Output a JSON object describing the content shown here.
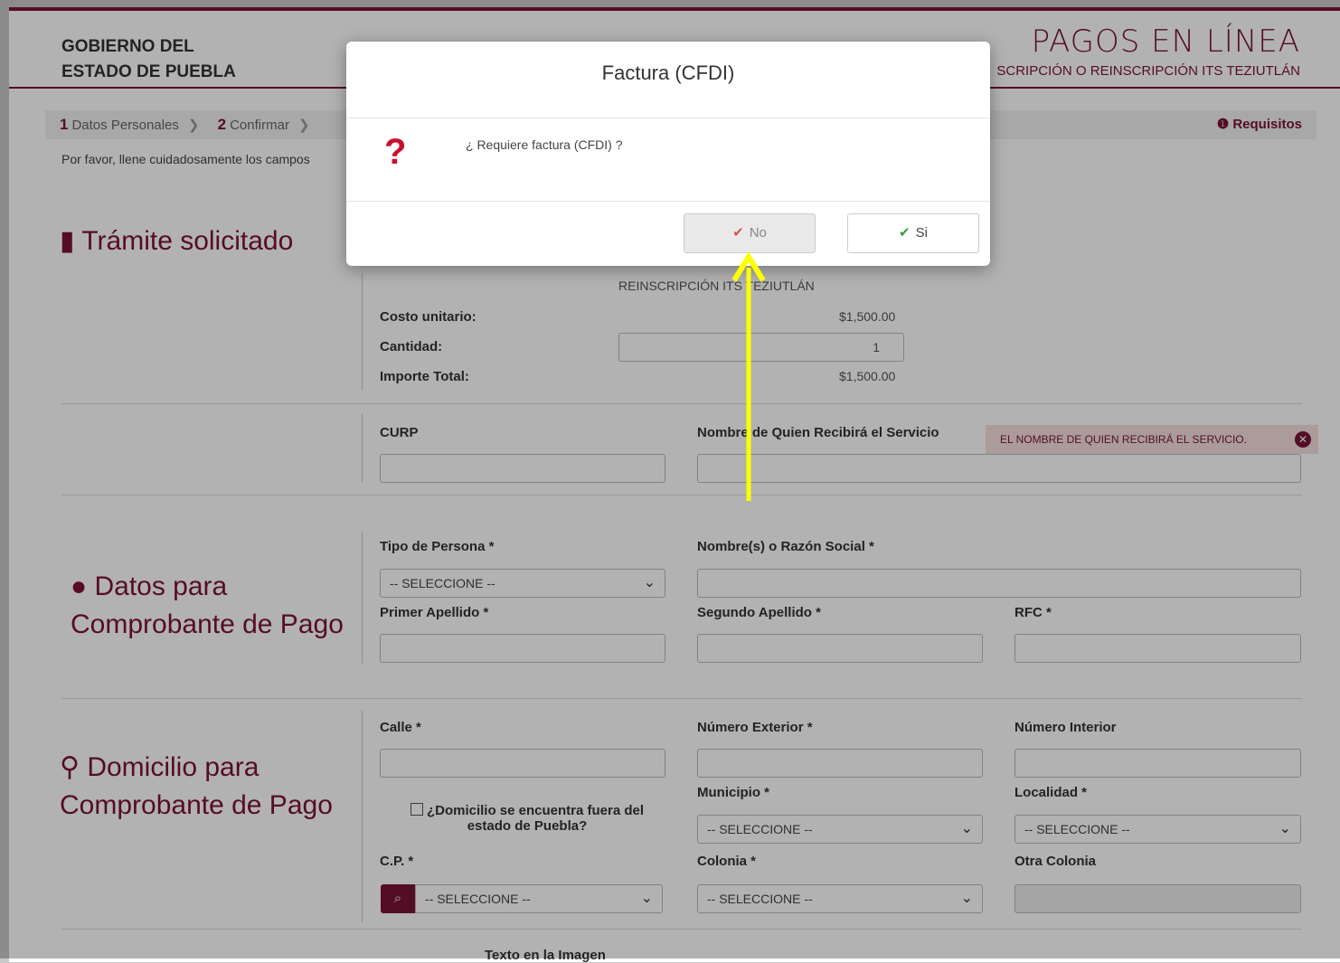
{
  "header": {
    "gov_line1": "GOBIERNO DEL",
    "gov_line2": "ESTADO DE PUEBLA",
    "brand_title": "PAGOS EN LÍNEA",
    "brand_sub": "SCRIPCIÓN O REINSCRIPCIÓN ITS TEZIUTLÁN"
  },
  "steps": [
    {
      "num": "1",
      "label": "Datos Personales"
    },
    {
      "num": "2",
      "label": "Confirmar"
    }
  ],
  "requisitos": "Requisitos",
  "instructions": "Por favor, llene cuidadosamente los campos",
  "tramite": {
    "title": "Trámite solicitado",
    "name": "REINSCRIPCIÓN ITS TEZIUTLÁN",
    "costo_label": "Costo unitario:",
    "costo_value": "$1,500.00",
    "cantidad_label": "Cantidad:",
    "cantidad_value": "1",
    "importe_label": "Importe Total:",
    "importe_value": "$1,500.00"
  },
  "curp_section": {
    "curp_label": "CURP",
    "nombre_label": "Nombre de Quien Recibirá el Servicio",
    "error": "EL NOMBRE DE QUIEN RECIBIRÁ EL SERVICIO."
  },
  "pago": {
    "title_line1": "Datos para",
    "title_line2": "Comprobante de Pago",
    "tipo_label": "Tipo de Persona *",
    "tipo_value": "-- SELECCIONE --",
    "nombre_label": "Nombre(s) o Razón Social *",
    "primer_label": "Primer Apellido *",
    "segundo_label": "Segundo Apellido *",
    "rfc_label": "RFC *"
  },
  "domicilio": {
    "title_line1": "Domicilio para",
    "title_line2": "Comprobante de Pago",
    "calle_label": "Calle *",
    "num_ext_label": "Número Exterior *",
    "num_int_label": "Número Interior",
    "municipio_label": "Municipio *",
    "localidad_label": "Localidad *",
    "fuera_line1": "¿Domicilio se encuentra fuera del",
    "fuera_line2": "estado de Puebla?",
    "cp_label": "C.P. *",
    "colonia_label": "Colonia *",
    "otra_colonia_label": "Otra Colonia",
    "select_value": "-- SELECCIONE --"
  },
  "footer_text": "Texto en la Imagen",
  "modal": {
    "title": "Factura (CFDI)",
    "message": "¿ Requiere factura (CFDI) ?",
    "no_label": "No",
    "si_label": "Si"
  },
  "colors": {
    "brand": "#7a1335",
    "arrow": "#ffff00"
  }
}
